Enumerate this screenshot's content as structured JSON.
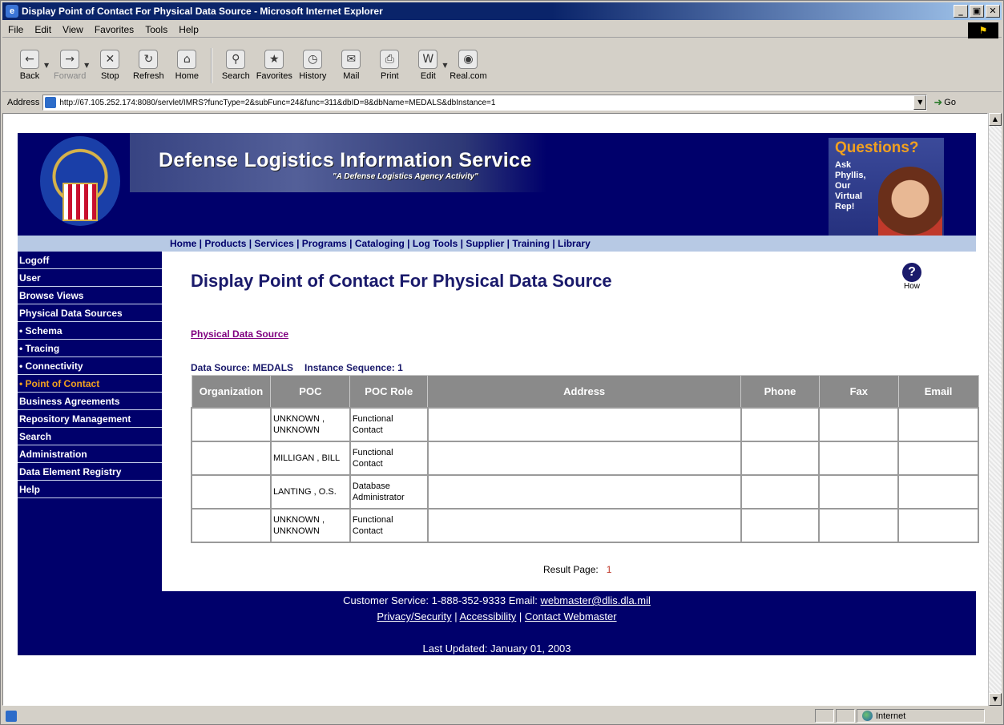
{
  "window": {
    "title": "Display Point of Contact For Physical Data Source - Microsoft Internet Explorer",
    "controls": [
      "_",
      "▣",
      "✕"
    ]
  },
  "menu": [
    "File",
    "Edit",
    "View",
    "Favorites",
    "Tools",
    "Help"
  ],
  "toolbar": {
    "back": "Back",
    "forward": "Forward",
    "stop": "Stop",
    "refresh": "Refresh",
    "home": "Home",
    "search": "Search",
    "favorites": "Favorites",
    "history": "History",
    "mail": "Mail",
    "print": "Print",
    "edit": "Edit",
    "real": "Real.com"
  },
  "address": {
    "label": "Address",
    "url": "http://67.105.252.174:8080/servlet/IMRS?funcType=2&subFunc=24&func=311&dbID=8&dbName=MEDALS&dbInstance=1",
    "go": "Go"
  },
  "banner": {
    "title": "Defense Logistics Information Service",
    "subtitle": "\"A Defense Logistics Agency Activity\"",
    "questions_title": "Questions?",
    "questions_text": "Ask Phyllis, Our Virtual Rep!"
  },
  "nav": {
    "links": "Home | Products | Services | Programs | Cataloging | Log Tools | Supplier | Training | Library"
  },
  "sidebar": {
    "items": [
      {
        "label": "Logoff"
      },
      {
        "label": "User"
      },
      {
        "label": "Browse Views"
      },
      {
        "label": "Physical Data Sources"
      },
      {
        "label": "• Schema"
      },
      {
        "label": "• Tracing"
      },
      {
        "label": "• Connectivity"
      },
      {
        "label": "• Point of Contact"
      },
      {
        "label": "Business Agreements"
      },
      {
        "label": "Repository Management"
      },
      {
        "label": "Search"
      },
      {
        "label": "Administration"
      },
      {
        "label": "Data Element Registry"
      },
      {
        "label": "Help"
      }
    ],
    "active_index": 7
  },
  "content": {
    "page_title": "Display Point of Contact For Physical Data Source",
    "how_label": "How",
    "pds_link": "Physical Data Source",
    "data_source_label": "Data Source: MEDALS",
    "instance_label": "Instance Sequence: 1",
    "table": {
      "headers": [
        "Organization",
        "POC",
        "POC Role",
        "Address",
        "Phone",
        "Fax",
        "Email"
      ],
      "rows": [
        {
          "organization": "",
          "poc": "UNKNOWN , UNKNOWN",
          "role": "Functional Contact",
          "address": "",
          "phone": "",
          "fax": "",
          "email": ""
        },
        {
          "organization": "",
          "poc": "MILLIGAN , BILL",
          "role": "Functional Contact",
          "address": "",
          "phone": "",
          "fax": "",
          "email": ""
        },
        {
          "organization": "",
          "poc": "LANTING , O.S.",
          "role": "Database Administrator",
          "address": "",
          "phone": "",
          "fax": "",
          "email": ""
        },
        {
          "organization": "",
          "poc": "UNKNOWN , UNKNOWN",
          "role": "Functional Contact",
          "address": "",
          "phone": "",
          "fax": "",
          "email": ""
        }
      ]
    },
    "result_label": "Result Page:",
    "result_page": "1"
  },
  "footer": {
    "customer_service": "Customer Service: 1-888-352-9333 Email: ",
    "email": "webmaster@dlis.dla.mil",
    "privacy": "Privacy/Security",
    "accessibility": "Accessibility",
    "contact": "Contact Webmaster",
    "updated": "Last Updated: January 01, 2003"
  },
  "status": {
    "zone": "Internet"
  }
}
